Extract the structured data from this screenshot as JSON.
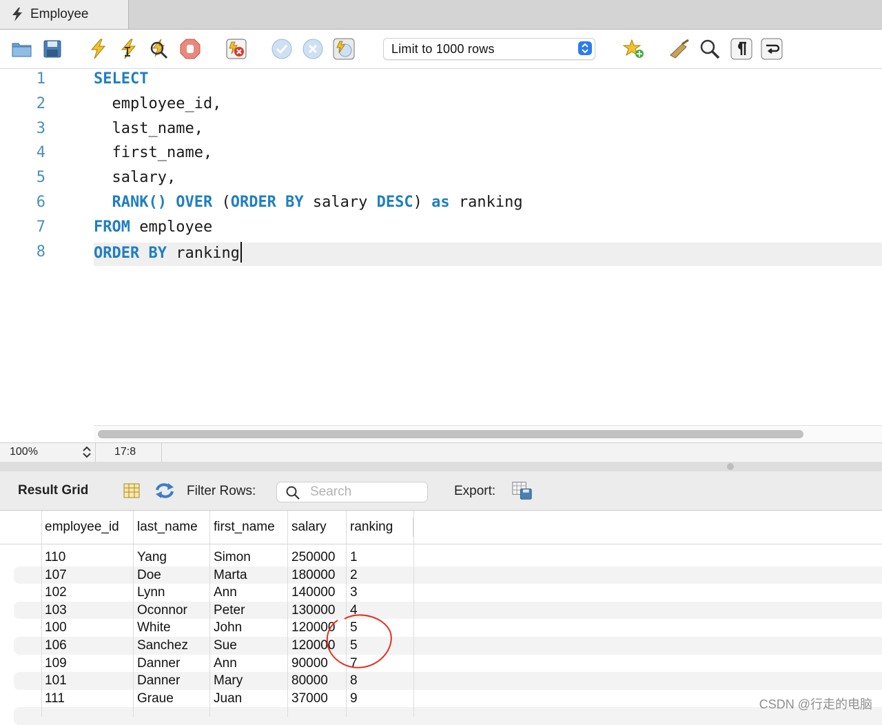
{
  "tab": {
    "title": "Employee",
    "icon": "lightning-icon"
  },
  "toolbar": {
    "icons": [
      "open-folder-icon",
      "save-disk-icon",
      "execute-lightning-icon",
      "execute-current-lightning-icon",
      "explain-magnifier-icon",
      "stop-hand-icon",
      "toggle-error-stop-icon",
      "commit-check-icon",
      "rollback-cancel-icon",
      "autocommit-toggle-icon",
      "add-snippet-star-icon",
      "beautify-brush-icon",
      "find-magnifier-icon",
      "invisible-chars-pilcrow-icon",
      "word-wrap-icon"
    ],
    "limit_select": "Limit to 1000 rows"
  },
  "editor": {
    "line_numbers": [
      "1",
      "2",
      "3",
      "4",
      "5",
      "6",
      "7",
      "8"
    ],
    "lines": [
      [
        {
          "t": "SELECT",
          "kw": true
        }
      ],
      [
        {
          "t": "  employee_id,",
          "kw": false
        }
      ],
      [
        {
          "t": "  last_name,",
          "kw": false
        }
      ],
      [
        {
          "t": "  first_name,",
          "kw": false
        }
      ],
      [
        {
          "t": "  salary,",
          "kw": false
        }
      ],
      [
        {
          "t": "  ",
          "kw": false
        },
        {
          "t": "RANK() OVER",
          "kw": true
        },
        {
          "t": " (",
          "kw": false
        },
        {
          "t": "ORDER BY",
          "kw": true
        },
        {
          "t": " salary ",
          "kw": false
        },
        {
          "t": "DESC",
          "kw": true
        },
        {
          "t": ") ",
          "kw": false
        },
        {
          "t": "as",
          "kw": true
        },
        {
          "t": " ranking",
          "kw": false
        }
      ],
      [
        {
          "t": "FROM",
          "kw": true
        },
        {
          "t": " employee",
          "kw": false
        }
      ],
      [
        {
          "t": "ORDER BY",
          "kw": true
        },
        {
          "t": " ranking",
          "kw": false
        }
      ]
    ],
    "keyword_color": "#1f7fc0"
  },
  "status": {
    "zoom": "100%",
    "cursor_pos": "17:8"
  },
  "results": {
    "title": "Result Grid",
    "filter_label": "Filter Rows:",
    "search_placeholder": "Search",
    "export_label": "Export:",
    "columns": [
      "employee_id",
      "last_name",
      "first_name",
      "salary",
      "ranking"
    ],
    "rows": [
      [
        "110",
        "Yang",
        "Simon",
        "250000",
        "1"
      ],
      [
        "107",
        "Doe",
        "Marta",
        "180000",
        "2"
      ],
      [
        "102",
        "Lynn",
        "Ann",
        "140000",
        "3"
      ],
      [
        "103",
        "Oconnor",
        "Peter",
        "130000",
        "4"
      ],
      [
        "100",
        "White",
        "John",
        "120000",
        "5"
      ],
      [
        "106",
        "Sanchez",
        "Sue",
        "120000",
        "5"
      ],
      [
        "109",
        "Danner",
        "Ann",
        "90000",
        "7"
      ],
      [
        "101",
        "Danner",
        "Mary",
        "80000",
        "8"
      ],
      [
        "111",
        "Graue",
        "Juan",
        "37000",
        "9"
      ]
    ]
  },
  "annotation_color": "#e0301e",
  "watermark": "CSDN @行走的电脑"
}
